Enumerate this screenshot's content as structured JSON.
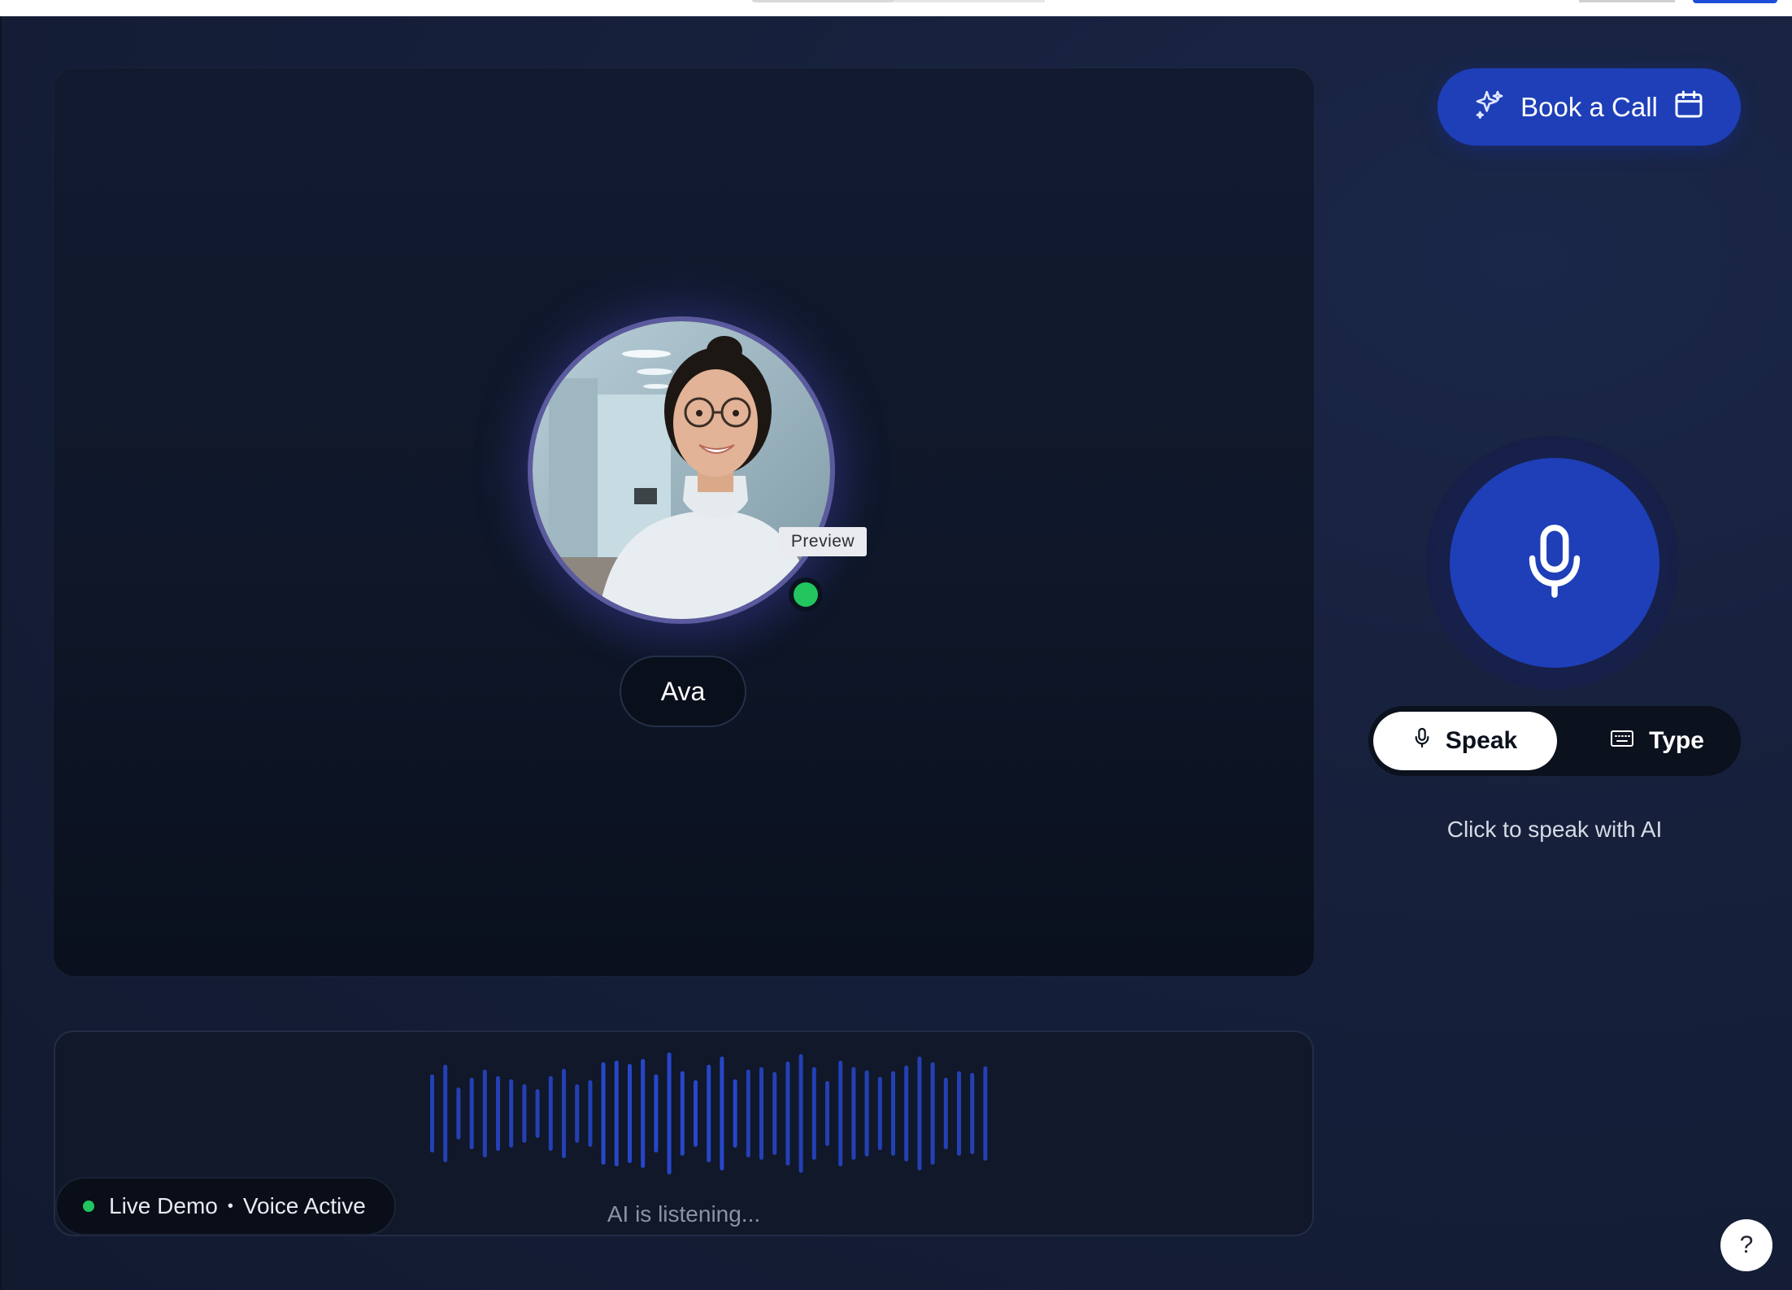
{
  "assistant": {
    "name": "Ava",
    "preview_label": "Preview",
    "status": "online"
  },
  "actions": {
    "book_call_label": "Book a Call"
  },
  "mode_toggle": {
    "speak_label": "Speak",
    "type_label": "Type",
    "selected": "Speak"
  },
  "hint": "Click to speak with AI",
  "waveform": {
    "status_text": "AI is listening..."
  },
  "status_pill": {
    "left": "Live Demo",
    "separator": "•",
    "right": "Voice Active"
  },
  "help": {
    "label": "?"
  },
  "colors": {
    "accent": "#1e3fb8",
    "online": "#22c55e",
    "background": "#16203b"
  },
  "icons": {
    "book_call_left": "sparkle-icon",
    "book_call_right": "calendar-icon",
    "mic_main": "microphone-icon",
    "speak": "microphone-icon",
    "type": "keyboard-icon"
  }
}
